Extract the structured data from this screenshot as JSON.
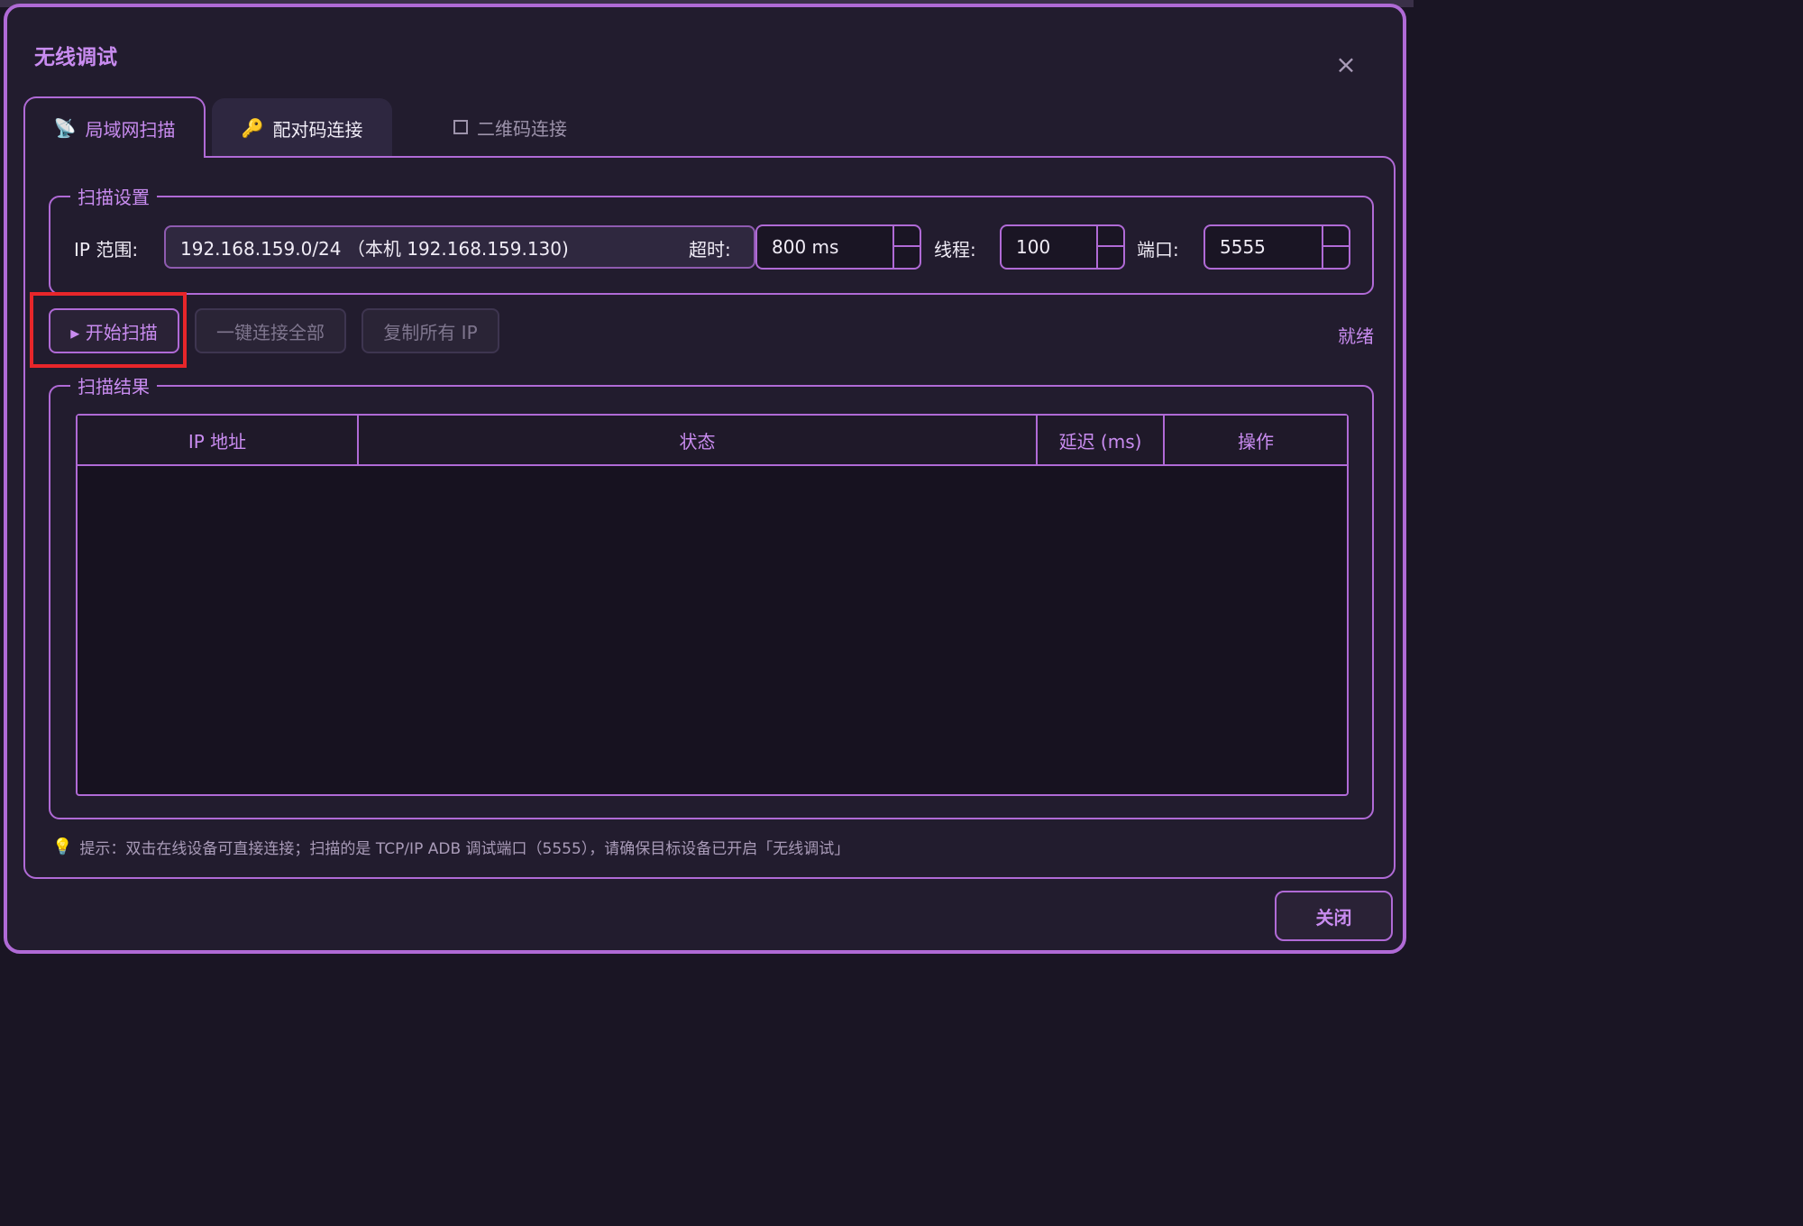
{
  "dialog": {
    "title": "无线调试",
    "close_glyph": "×"
  },
  "tabs": [
    {
      "label": "局域网扫描",
      "icon": "satellite-dish-icon",
      "glyph": "📡",
      "active": true
    },
    {
      "label": "配对码连接",
      "icon": "key-icon",
      "glyph": "🔑",
      "active": false
    },
    {
      "label": "二维码连接",
      "icon": "checkbox-icon",
      "glyph": "",
      "active": false
    }
  ],
  "settings": {
    "legend": "扫描设置",
    "ip_label": "IP 范围:",
    "ip_value": "192.168.159.0/24 （本机 192.168.159.130)",
    "timeout_label": "超时:",
    "timeout_value": "800 ms",
    "threads_label": "线程:",
    "threads_value": "100",
    "port_label": "端口:",
    "port_value": "5555"
  },
  "actions": {
    "start_label": "▸ 开始扫描",
    "connect_all_label": "一键连接全部",
    "copy_label": "复制所有 IP",
    "status": "就绪"
  },
  "results": {
    "legend": "扫描结果",
    "columns": [
      "IP 地址",
      "状态",
      "延迟 (ms)",
      "操作"
    ],
    "rows": []
  },
  "hint": {
    "icon": "lightbulb-icon",
    "glyph": "💡",
    "text": "提示：双击在线设备可直接连接；扫描的是 TCP/IP ADB 调试端口（5555），请确保目标设备已开启「无线调试」"
  },
  "footer": {
    "close_label": "关闭"
  },
  "colors": {
    "accent": "#b06ad6",
    "accent_text": "#c98cf0",
    "background": "#221c2e",
    "highlight": "#e8262a"
  }
}
